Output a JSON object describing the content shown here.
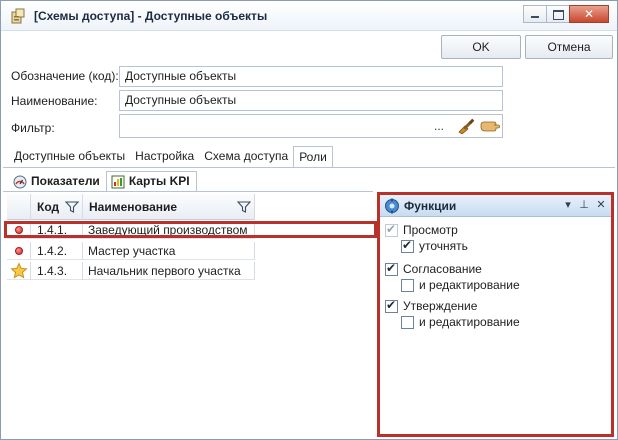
{
  "window": {
    "title": "[Схемы доступа] - Доступные объекты",
    "icons": [
      "app-icon",
      "minimize-icon",
      "maximize-icon",
      "close-icon"
    ]
  },
  "buttons": {
    "ok": "OK",
    "cancel": "Отмена"
  },
  "form": {
    "code_label": "Обозначение (код):",
    "code_value": "Доступные объекты",
    "name_label": "Наименование:",
    "name_value": "Доступные объекты",
    "filter_label": "Фильтр:",
    "filter_value": "",
    "filter_ellipsis": "...",
    "filter_icons": [
      "broom-icon",
      "hand-icon"
    ]
  },
  "tabs": [
    {
      "label": "Доступные объекты",
      "active": false
    },
    {
      "label": "Настройка",
      "active": false
    },
    {
      "label": "Схема доступа",
      "active": false
    },
    {
      "label": "Роли",
      "active": true
    }
  ],
  "subtabs": [
    {
      "label": "Показатели",
      "icon": "indicators-icon",
      "active": false
    },
    {
      "label": "Карты KPI",
      "icon": "kpi-card-icon",
      "active": true
    }
  ],
  "grid": {
    "columns": [
      "Код",
      "Наименование"
    ],
    "rows": [
      {
        "code": "1.4.1.",
        "name": "Заведующий производством",
        "marker": "red-dot",
        "selected": true
      },
      {
        "code": "1.4.2.",
        "name": "Мастер участка",
        "marker": "red-dot",
        "selected": false
      },
      {
        "code": "1.4.3.",
        "name": "Начальник первого участка",
        "marker": "star",
        "selected": false
      }
    ]
  },
  "functions_panel": {
    "title": "Функции",
    "header_buttons": [
      "dropdown-icon",
      "pin-icon",
      "close-icon"
    ],
    "items": [
      {
        "label": "Просмотр",
        "checked": true,
        "disabled": true,
        "level": 0
      },
      {
        "label": "уточнять",
        "checked": true,
        "disabled": false,
        "level": 1
      },
      {
        "label": "Согласование",
        "checked": true,
        "disabled": false,
        "level": 0
      },
      {
        "label": "и редактирование",
        "checked": false,
        "disabled": false,
        "level": 1
      },
      {
        "label": "Утверждение",
        "checked": true,
        "disabled": false,
        "level": 0
      },
      {
        "label": "и редактирование",
        "checked": false,
        "disabled": false,
        "level": 1
      }
    ]
  },
  "colors": {
    "highlight": "#b8312a",
    "panel_header": "#c9dcf0",
    "border": "#b8c4d2"
  }
}
